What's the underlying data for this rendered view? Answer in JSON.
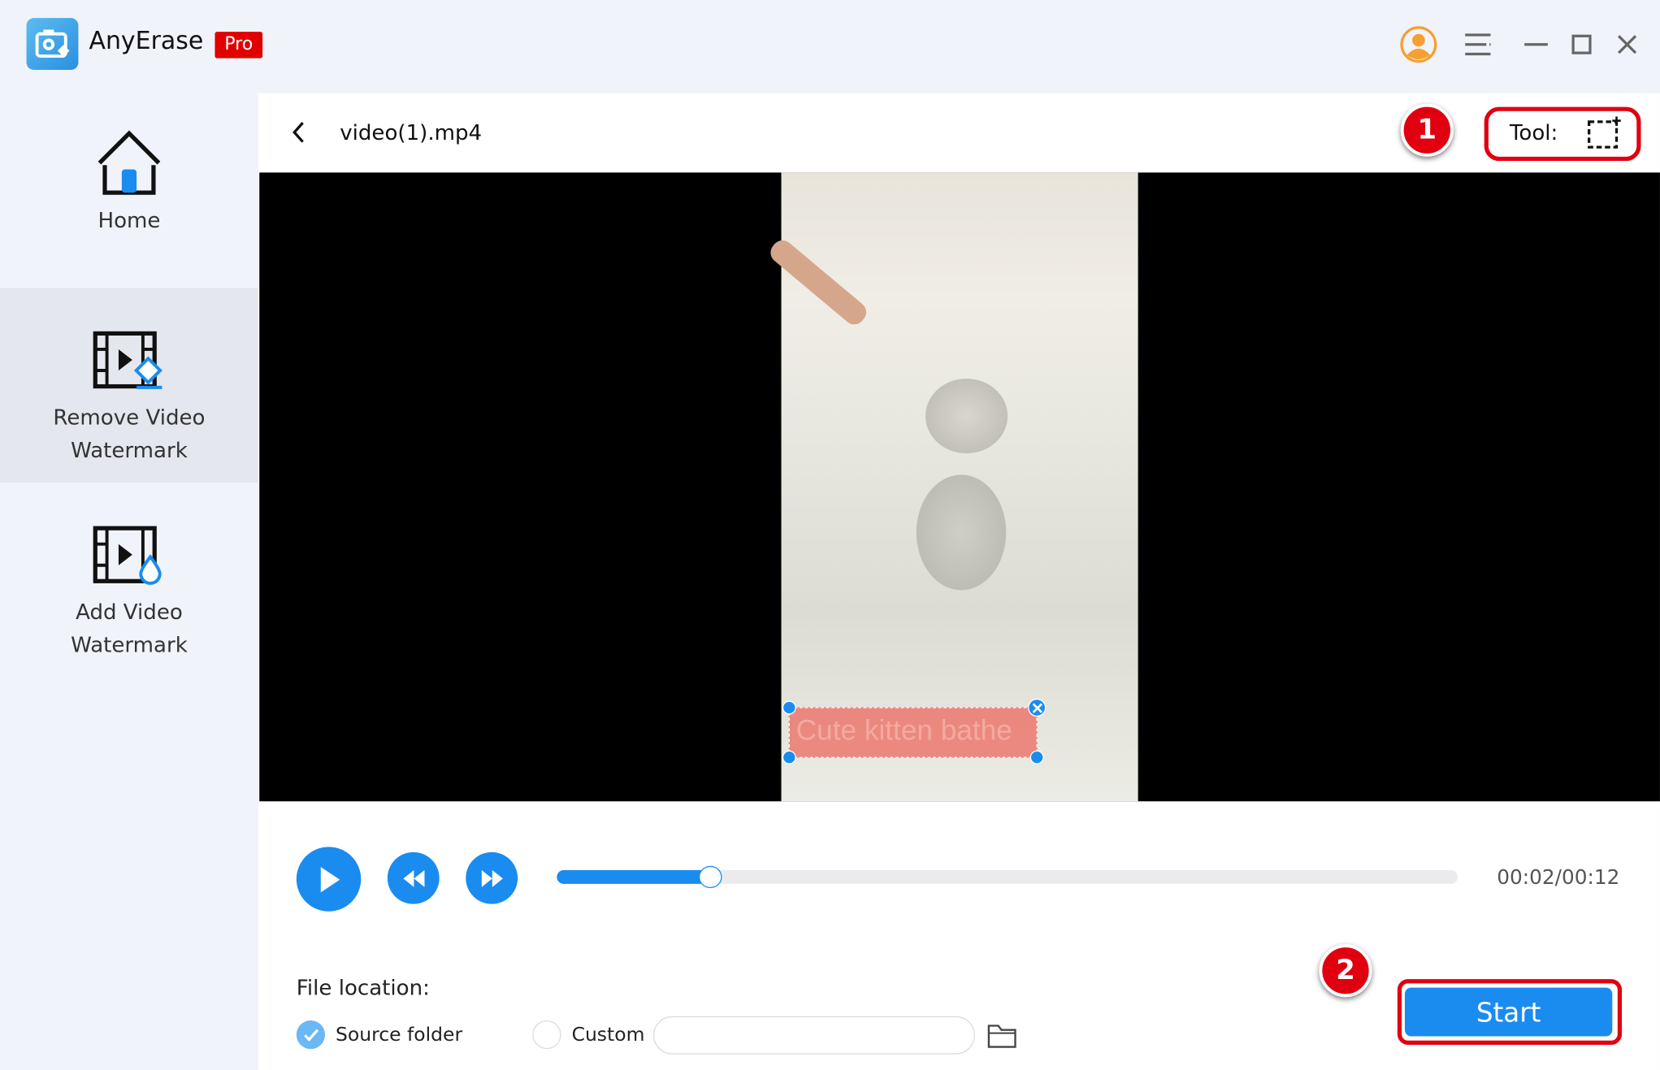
{
  "app": {
    "name": "AnyErase",
    "badge": "Pro"
  },
  "window": {
    "icons": [
      "user-avatar-icon",
      "menu-icon",
      "minimize-icon",
      "maximize-icon",
      "close-icon"
    ]
  },
  "sidebar": {
    "items": [
      {
        "label": "Home",
        "icon": "home-icon",
        "active": false
      },
      {
        "label_line1": "Remove Video",
        "label_line2": "Watermark",
        "icon": "remove-video-watermark-icon",
        "active": true
      },
      {
        "label_line1": "Add Video",
        "label_line2": "Watermark",
        "icon": "add-video-watermark-icon",
        "active": false
      }
    ]
  },
  "header": {
    "file_name": "video(1).mp4",
    "tool_label": "Tool:",
    "tool_icon": "rectangle-select-icon"
  },
  "annotations": {
    "step1": "1",
    "step2": "2",
    "highlight_color": "#e00010"
  },
  "video": {
    "selection_text": "Cute kitten bathe"
  },
  "player": {
    "time": "00:02/00:12",
    "progress": 0.17,
    "accent": "#1a8cf0"
  },
  "output": {
    "file_location_label": "File location:",
    "source_folder_label": "Source folder",
    "source_folder_checked": true,
    "custom_label": "Custom",
    "custom_checked": false,
    "custom_path_value": "",
    "start_label": "Start"
  }
}
